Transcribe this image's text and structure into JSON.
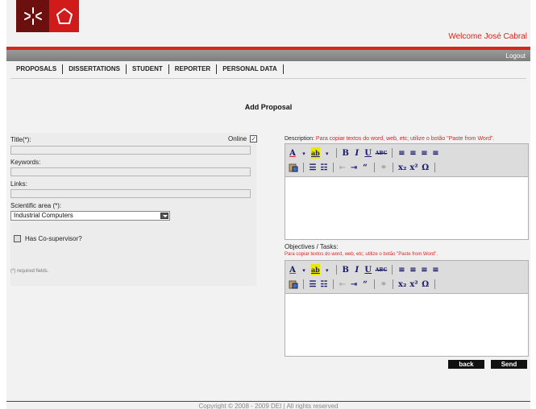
{
  "header": {
    "welcome": "Welcome José Cabral",
    "logout": "Logout"
  },
  "nav": {
    "items": [
      "PROPOSALS",
      "DISSERTATIONS",
      "STUDENT",
      "REPORTER",
      "PERSONAL DATA"
    ]
  },
  "page": {
    "title": "Add Proposal"
  },
  "form": {
    "title_label": "Title(*):",
    "online_label": "Online",
    "online_checked": true,
    "online_mark": "✓",
    "keywords_label": "Keywords:",
    "links_label": "Links:",
    "scientific_area_label": "Scientific area (*):",
    "scientific_area_value": "Industrial Computers",
    "cosupervisor_label": "Has Co-supervisor?",
    "required_note": "(*) required fields."
  },
  "description": {
    "label": "Description:",
    "hint": "Para copiar textos do word, web, etc; utilize o botão \"Paste from Word\"."
  },
  "objectives": {
    "label": "Objectives / Tasks:",
    "hint": "Para copiar textos do word, web, etc; utilize o botão \"Paste from Word\"."
  },
  "toolbar": {
    "row1": [
      "A",
      "ab",
      "B",
      "I",
      "U",
      "ABC"
    ],
    "row2": [
      "“",
      "x₂",
      "x²",
      "Ω"
    ]
  },
  "actions": {
    "back": "back",
    "send": "Send"
  },
  "footer": {
    "text": "Copyright © 2008 - 2009  DEI  |  All rights reserved"
  }
}
